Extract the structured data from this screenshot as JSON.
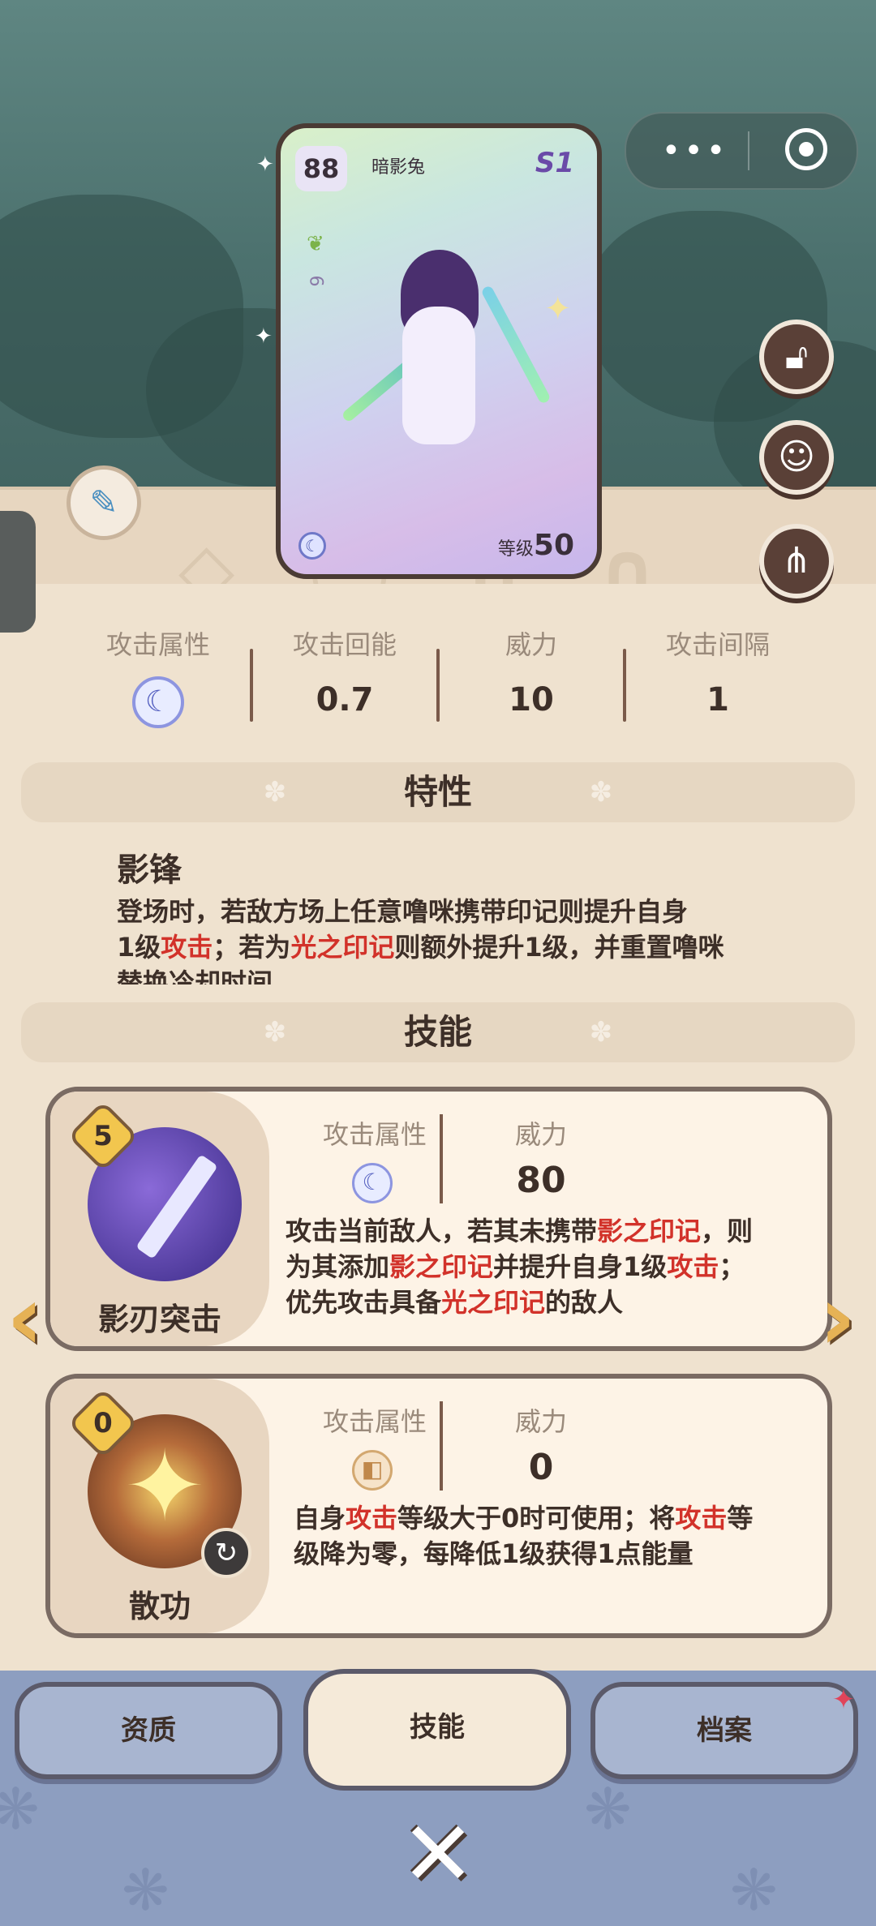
{
  "card": {
    "level_badge": "88",
    "name": "暗影兔",
    "season": "S1",
    "stat_small": "6",
    "level_label": "等级",
    "level_value": "50"
  },
  "stats": {
    "attack_attr_label": "攻击属性",
    "attack_attr_icon": "moon-icon",
    "energy_label": "攻击回能",
    "energy_value": "0.7",
    "power_label": "威力",
    "power_value": "10",
    "interval_label": "攻击间隔",
    "interval_value": "1"
  },
  "trait": {
    "section_title": "特性",
    "name": "影锋",
    "desc_1": "登场时，若敌方场上任意噜咪携带印记则提升自身",
    "desc_2a": "1级",
    "desc_2b": "攻击",
    "desc_2c": "；若为",
    "desc_2d": "光之印记",
    "desc_2e": "则额外提升1级，并重置噜咪",
    "desc_3": "替换冷却时间"
  },
  "skills_section_title": "技能",
  "skills": [
    {
      "cost": "5",
      "name": "影刃突击",
      "attr_label": "攻击属性",
      "attr_icon": "moon-icon",
      "power_label": "威力",
      "power_value": "80",
      "d1": "攻击当前敌人，若其未携带",
      "d2": "影之印记",
      "d3": "，则",
      "d4": "为其添加",
      "d5": "影之印记",
      "d6": "并提升自身1级",
      "d7": "攻击",
      "d8": "；",
      "d9": "优先攻击具备",
      "d10": "光之印记",
      "d11": "的敌人"
    },
    {
      "cost": "0",
      "name": "散功",
      "attr_label": "攻击属性",
      "attr_icon": "light-icon",
      "power_label": "威力",
      "power_value": "0",
      "d1": "自身",
      "d2": "攻击",
      "d3": "等级大于0时可使用；将",
      "d4": "攻击",
      "d5": "等",
      "d6": "级降为零，每降低1级获得1点能量"
    }
  ],
  "tabs": [
    {
      "label": "资质"
    },
    {
      "label": "技能"
    },
    {
      "label": "档案"
    }
  ],
  "capsule": {
    "more": "•••"
  },
  "colors": {
    "accent_red": "#d2322a",
    "brown": "#3d2f28"
  }
}
